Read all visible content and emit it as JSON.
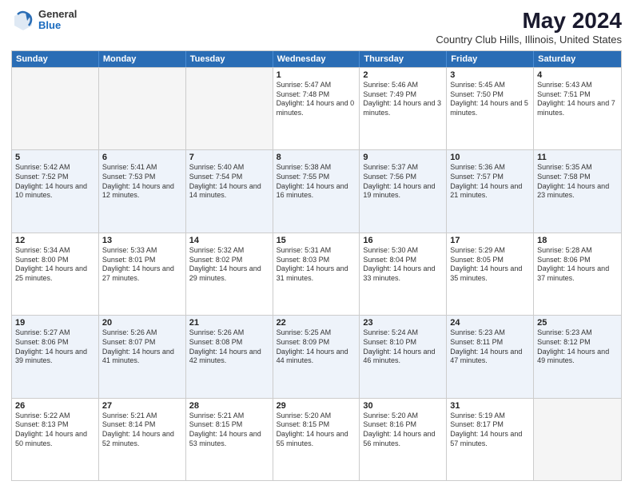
{
  "logo": {
    "general": "General",
    "blue": "Blue"
  },
  "title": "May 2024",
  "subtitle": "Country Club Hills, Illinois, United States",
  "header_days": [
    "Sunday",
    "Monday",
    "Tuesday",
    "Wednesday",
    "Thursday",
    "Friday",
    "Saturday"
  ],
  "rows": [
    [
      {
        "day": "",
        "sunrise": "",
        "sunset": "",
        "daylight": "",
        "empty": true
      },
      {
        "day": "",
        "sunrise": "",
        "sunset": "",
        "daylight": "",
        "empty": true
      },
      {
        "day": "",
        "sunrise": "",
        "sunset": "",
        "daylight": "",
        "empty": true
      },
      {
        "day": "1",
        "sunrise": "Sunrise: 5:47 AM",
        "sunset": "Sunset: 7:48 PM",
        "daylight": "Daylight: 14 hours and 0 minutes.",
        "empty": false
      },
      {
        "day": "2",
        "sunrise": "Sunrise: 5:46 AM",
        "sunset": "Sunset: 7:49 PM",
        "daylight": "Daylight: 14 hours and 3 minutes.",
        "empty": false
      },
      {
        "day": "3",
        "sunrise": "Sunrise: 5:45 AM",
        "sunset": "Sunset: 7:50 PM",
        "daylight": "Daylight: 14 hours and 5 minutes.",
        "empty": false
      },
      {
        "day": "4",
        "sunrise": "Sunrise: 5:43 AM",
        "sunset": "Sunset: 7:51 PM",
        "daylight": "Daylight: 14 hours and 7 minutes.",
        "empty": false
      }
    ],
    [
      {
        "day": "5",
        "sunrise": "Sunrise: 5:42 AM",
        "sunset": "Sunset: 7:52 PM",
        "daylight": "Daylight: 14 hours and 10 minutes.",
        "empty": false
      },
      {
        "day": "6",
        "sunrise": "Sunrise: 5:41 AM",
        "sunset": "Sunset: 7:53 PM",
        "daylight": "Daylight: 14 hours and 12 minutes.",
        "empty": false
      },
      {
        "day": "7",
        "sunrise": "Sunrise: 5:40 AM",
        "sunset": "Sunset: 7:54 PM",
        "daylight": "Daylight: 14 hours and 14 minutes.",
        "empty": false
      },
      {
        "day": "8",
        "sunrise": "Sunrise: 5:38 AM",
        "sunset": "Sunset: 7:55 PM",
        "daylight": "Daylight: 14 hours and 16 minutes.",
        "empty": false
      },
      {
        "day": "9",
        "sunrise": "Sunrise: 5:37 AM",
        "sunset": "Sunset: 7:56 PM",
        "daylight": "Daylight: 14 hours and 19 minutes.",
        "empty": false
      },
      {
        "day": "10",
        "sunrise": "Sunrise: 5:36 AM",
        "sunset": "Sunset: 7:57 PM",
        "daylight": "Daylight: 14 hours and 21 minutes.",
        "empty": false
      },
      {
        "day": "11",
        "sunrise": "Sunrise: 5:35 AM",
        "sunset": "Sunset: 7:58 PM",
        "daylight": "Daylight: 14 hours and 23 minutes.",
        "empty": false
      }
    ],
    [
      {
        "day": "12",
        "sunrise": "Sunrise: 5:34 AM",
        "sunset": "Sunset: 8:00 PM",
        "daylight": "Daylight: 14 hours and 25 minutes.",
        "empty": false
      },
      {
        "day": "13",
        "sunrise": "Sunrise: 5:33 AM",
        "sunset": "Sunset: 8:01 PM",
        "daylight": "Daylight: 14 hours and 27 minutes.",
        "empty": false
      },
      {
        "day": "14",
        "sunrise": "Sunrise: 5:32 AM",
        "sunset": "Sunset: 8:02 PM",
        "daylight": "Daylight: 14 hours and 29 minutes.",
        "empty": false
      },
      {
        "day": "15",
        "sunrise": "Sunrise: 5:31 AM",
        "sunset": "Sunset: 8:03 PM",
        "daylight": "Daylight: 14 hours and 31 minutes.",
        "empty": false
      },
      {
        "day": "16",
        "sunrise": "Sunrise: 5:30 AM",
        "sunset": "Sunset: 8:04 PM",
        "daylight": "Daylight: 14 hours and 33 minutes.",
        "empty": false
      },
      {
        "day": "17",
        "sunrise": "Sunrise: 5:29 AM",
        "sunset": "Sunset: 8:05 PM",
        "daylight": "Daylight: 14 hours and 35 minutes.",
        "empty": false
      },
      {
        "day": "18",
        "sunrise": "Sunrise: 5:28 AM",
        "sunset": "Sunset: 8:06 PM",
        "daylight": "Daylight: 14 hours and 37 minutes.",
        "empty": false
      }
    ],
    [
      {
        "day": "19",
        "sunrise": "Sunrise: 5:27 AM",
        "sunset": "Sunset: 8:06 PM",
        "daylight": "Daylight: 14 hours and 39 minutes.",
        "empty": false
      },
      {
        "day": "20",
        "sunrise": "Sunrise: 5:26 AM",
        "sunset": "Sunset: 8:07 PM",
        "daylight": "Daylight: 14 hours and 41 minutes.",
        "empty": false
      },
      {
        "day": "21",
        "sunrise": "Sunrise: 5:26 AM",
        "sunset": "Sunset: 8:08 PM",
        "daylight": "Daylight: 14 hours and 42 minutes.",
        "empty": false
      },
      {
        "day": "22",
        "sunrise": "Sunrise: 5:25 AM",
        "sunset": "Sunset: 8:09 PM",
        "daylight": "Daylight: 14 hours and 44 minutes.",
        "empty": false
      },
      {
        "day": "23",
        "sunrise": "Sunrise: 5:24 AM",
        "sunset": "Sunset: 8:10 PM",
        "daylight": "Daylight: 14 hours and 46 minutes.",
        "empty": false
      },
      {
        "day": "24",
        "sunrise": "Sunrise: 5:23 AM",
        "sunset": "Sunset: 8:11 PM",
        "daylight": "Daylight: 14 hours and 47 minutes.",
        "empty": false
      },
      {
        "day": "25",
        "sunrise": "Sunrise: 5:23 AM",
        "sunset": "Sunset: 8:12 PM",
        "daylight": "Daylight: 14 hours and 49 minutes.",
        "empty": false
      }
    ],
    [
      {
        "day": "26",
        "sunrise": "Sunrise: 5:22 AM",
        "sunset": "Sunset: 8:13 PM",
        "daylight": "Daylight: 14 hours and 50 minutes.",
        "empty": false
      },
      {
        "day": "27",
        "sunrise": "Sunrise: 5:21 AM",
        "sunset": "Sunset: 8:14 PM",
        "daylight": "Daylight: 14 hours and 52 minutes.",
        "empty": false
      },
      {
        "day": "28",
        "sunrise": "Sunrise: 5:21 AM",
        "sunset": "Sunset: 8:15 PM",
        "daylight": "Daylight: 14 hours and 53 minutes.",
        "empty": false
      },
      {
        "day": "29",
        "sunrise": "Sunrise: 5:20 AM",
        "sunset": "Sunset: 8:15 PM",
        "daylight": "Daylight: 14 hours and 55 minutes.",
        "empty": false
      },
      {
        "day": "30",
        "sunrise": "Sunrise: 5:20 AM",
        "sunset": "Sunset: 8:16 PM",
        "daylight": "Daylight: 14 hours and 56 minutes.",
        "empty": false
      },
      {
        "day": "31",
        "sunrise": "Sunrise: 5:19 AM",
        "sunset": "Sunset: 8:17 PM",
        "daylight": "Daylight: 14 hours and 57 minutes.",
        "empty": false
      },
      {
        "day": "",
        "sunrise": "",
        "sunset": "",
        "daylight": "",
        "empty": true
      }
    ]
  ]
}
